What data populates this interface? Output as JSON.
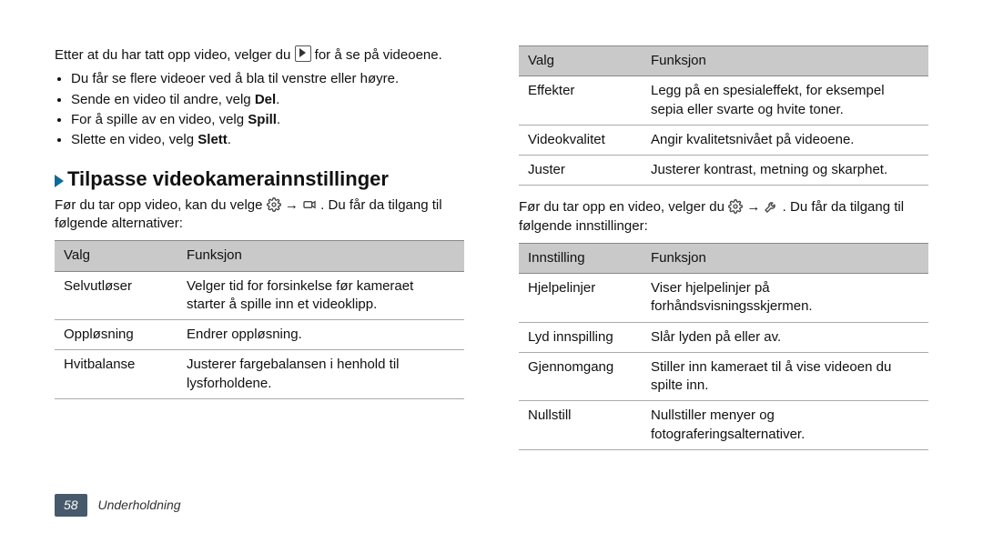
{
  "intro_before_icon": "Etter at du har tatt opp video, velger du ",
  "intro_after_icon": " for å se på videoene.",
  "bullets": [
    {
      "text": "Du får se flere videoer ved å bla til venstre eller høyre."
    },
    {
      "prefix": "Sende en video til andre, velg ",
      "bold": "Del",
      "suffix": "."
    },
    {
      "prefix": "For å spille av en video, velg ",
      "bold": "Spill",
      "suffix": "."
    },
    {
      "prefix": "Slette en video, velg ",
      "bold": "Slett",
      "suffix": "."
    }
  ],
  "section_heading": "Tilpasse videokamerainnstillinger",
  "sub_before": "Før du tar opp video, kan du velge ",
  "sub_mid": " → ",
  "sub_after": ". Du får da tilgang til følgende alternativer:",
  "table1": {
    "head": [
      "Valg",
      "Funksjon"
    ],
    "rows": [
      [
        "Selvutløser",
        "Velger tid for forsinkelse før kameraet starter å spille inn et videoklipp."
      ],
      [
        "Oppløsning",
        "Endrer oppløsning."
      ],
      [
        "Hvitbalanse",
        "Justerer fargebalansen i henhold til lysforholdene."
      ]
    ]
  },
  "table1b": {
    "head": [
      "Valg",
      "Funksjon"
    ],
    "rows": [
      [
        "Effekter",
        "Legg på en spesialeffekt, for eksempel sepia eller svarte og hvite toner."
      ],
      [
        "Videokvalitet",
        "Angir kvalitetsnivået på videoene."
      ],
      [
        "Juster",
        "Justerer kontrast, metning og skarphet."
      ]
    ]
  },
  "settings_before": "Før du tar opp en video, velger du ",
  "settings_mid": " → ",
  "settings_after": ". Du får da tilgang til følgende innstillinger:",
  "table2": {
    "head": [
      "Innstilling",
      "Funksjon"
    ],
    "rows": [
      [
        "Hjelpelinjer",
        "Viser hjelpelinjer på forhåndsvisningsskjermen."
      ],
      [
        "Lyd innspilling",
        "Slår lyden på eller av."
      ],
      [
        "Gjennomgang",
        "Stiller inn kameraet til å vise videoen du spilte inn."
      ],
      [
        "Nullstill",
        "Nullstiller menyer og fotograferingsalternativer."
      ]
    ]
  },
  "footer": {
    "page": "58",
    "section": "Underholdning"
  }
}
